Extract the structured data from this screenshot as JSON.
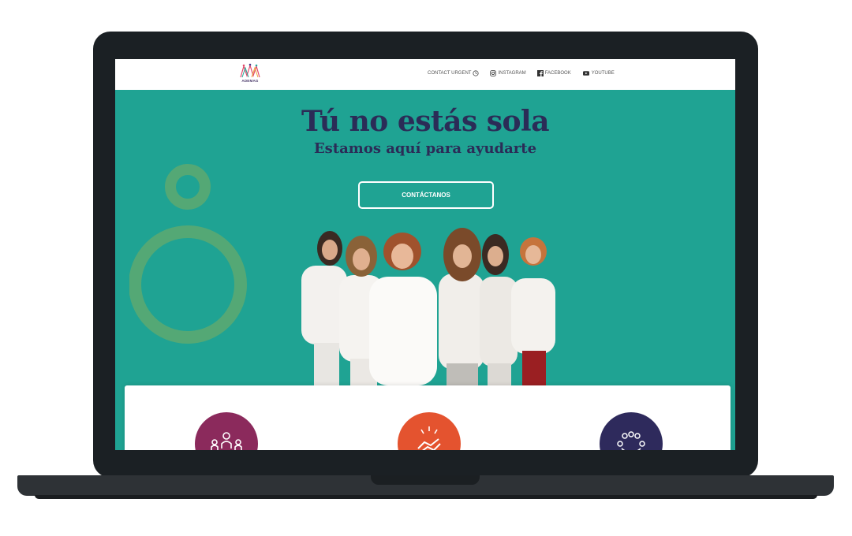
{
  "navbar": {
    "logo_text": "ADEMAG",
    "links": [
      {
        "label": "CONTACT URGENT",
        "icon": "clock-icon"
      },
      {
        "label": "INSTAGRAM",
        "icon": "instagram-icon"
      },
      {
        "label": "FACEBOOK",
        "icon": "facebook-icon"
      },
      {
        "label": "YOUTUBE",
        "icon": "youtube-icon"
      }
    ]
  },
  "hero": {
    "title": "Tú no estás sola",
    "subtitle": "Estamos aquí para ayudarte",
    "cta_label": "CONTÁCTANOS",
    "background_color": "#1fa393",
    "title_color": "#2b2c57"
  },
  "cards": [
    {
      "icon": "group-people-icon",
      "color": "#8b2a5c"
    },
    {
      "icon": "handshake-icon",
      "color": "#e4532f"
    },
    {
      "icon": "community-circle-icon",
      "color": "#2e2a5c"
    }
  ]
}
